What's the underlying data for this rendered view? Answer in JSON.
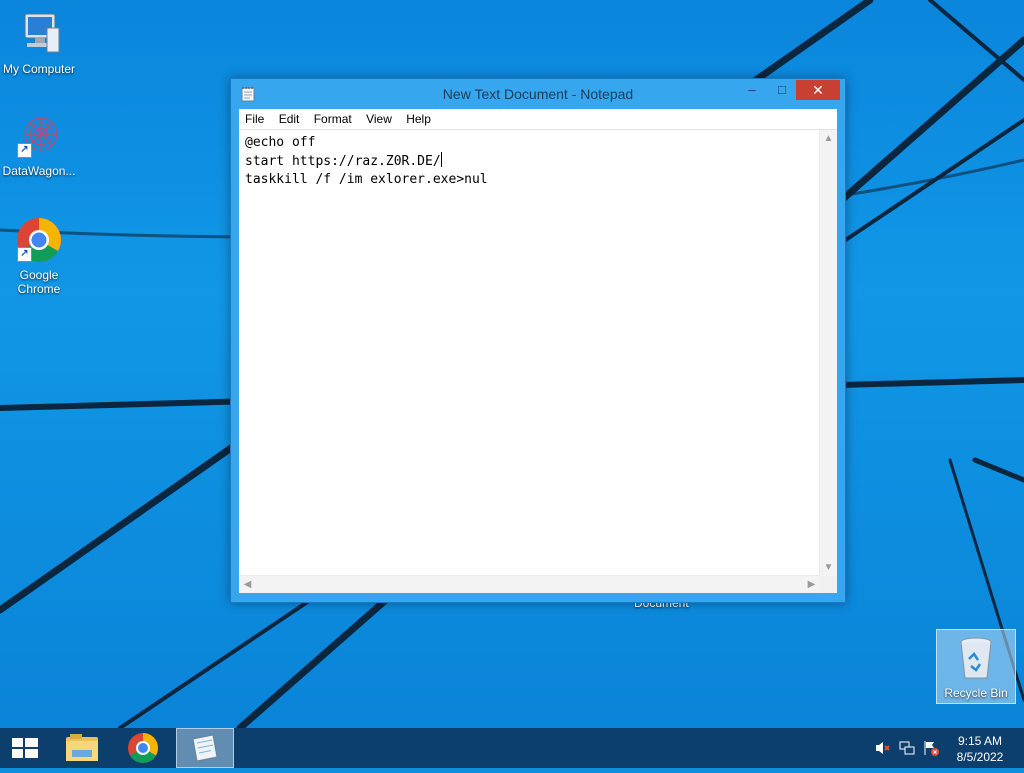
{
  "desktop": {
    "icons": [
      {
        "label": "My Computer"
      },
      {
        "label": "DataWagon..."
      },
      {
        "label_line1": "Google",
        "label_line2": "Chrome"
      },
      {
        "label": "Recycle Bin"
      }
    ],
    "stray_label": "Document"
  },
  "notepad": {
    "title": "New Text Document - Notepad",
    "controls": {
      "minimize": "–",
      "maximize": "□",
      "close": "✕"
    },
    "menu": [
      "File",
      "Edit",
      "Format",
      "View",
      "Help"
    ],
    "lines": [
      "@echo off",
      "start https://raz.Z0R.DE/",
      "taskkill /f /im exlorer.exe>nul"
    ]
  },
  "taskbar": {
    "clock_time": "9:15 AM",
    "clock_date": "8/5/2022"
  },
  "colors": {
    "accent": "#36a7ef",
    "close": "#c84031",
    "taskbar": "#0d3f6e"
  }
}
